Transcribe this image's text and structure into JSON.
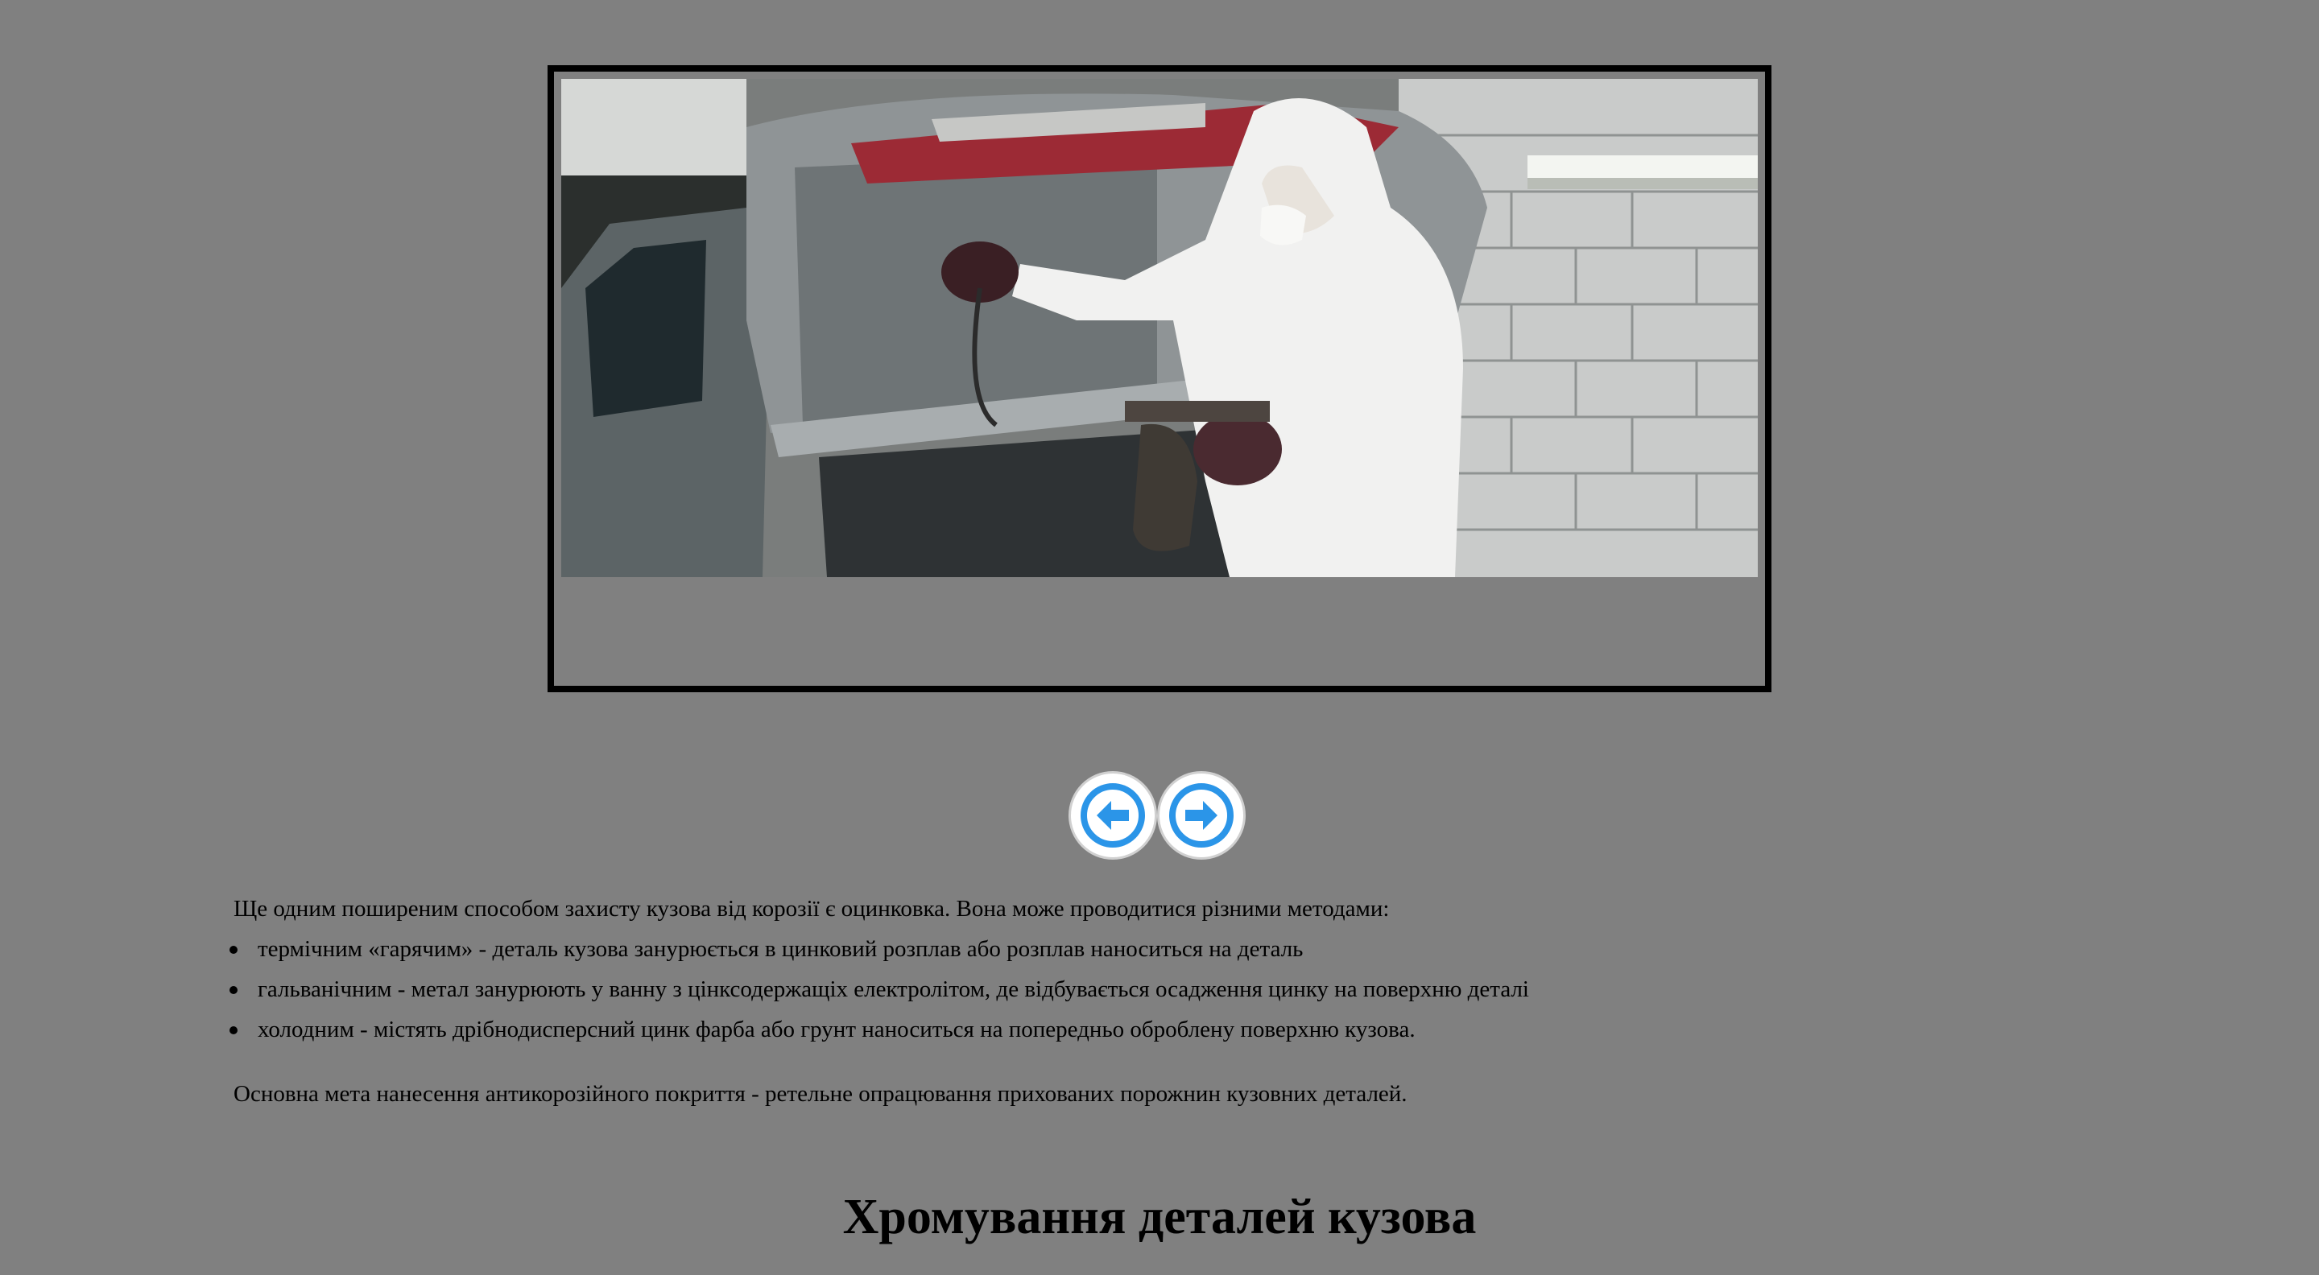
{
  "gallery": {
    "image_alt": "",
    "prev_icon": "arrow-left-icon",
    "next_icon": "arrow-right-icon",
    "accent_color": "#2b95e8"
  },
  "article": {
    "intro": "Ще одним поширеним способом захисту кузова від корозії є оцинковка. Вона може проводитися різними методами:",
    "methods": [
      "термічним «гарячим» - деталь кузова занурюється в цинковий розплав або розплав наноситься на деталь",
      "гальванічним - метал занурюють у ванну з цінксодержащіх електролітом, де відбувається осадження цинку на поверхню деталі",
      "холодним - містять дрібнодисперсний цинк фарба або грунт наноситься на попередньо оброблену поверхню кузова."
    ],
    "conclusion": "Основна мета нанесення антикорозійного покриття - ретельне опрацювання прихованих порожнин кузовних деталей.",
    "section_heading": "Хромування деталей кузова"
  }
}
